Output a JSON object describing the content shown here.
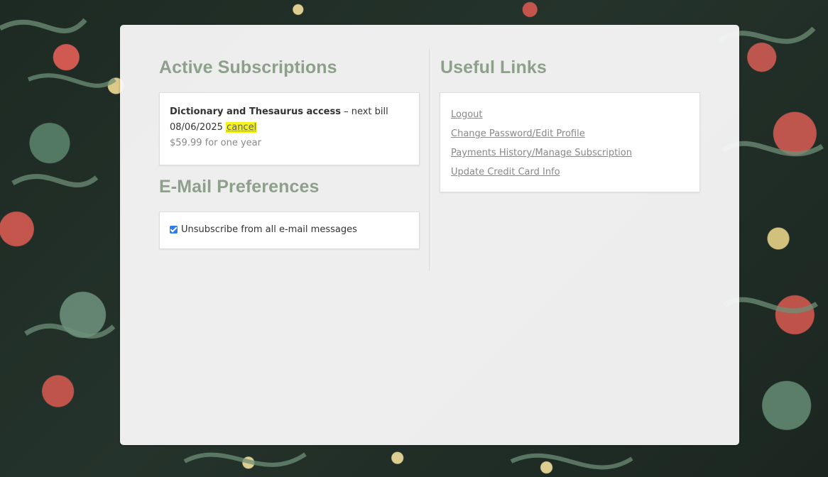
{
  "sections": {
    "active_subscriptions": {
      "title": "Active Subscriptions",
      "subscription": {
        "name": "Dictionary and Thesaurus access",
        "bill_text": " – next bill",
        "bill_date": "08/06/2025",
        "cancel_label": "cancel",
        "price": "$59.99 for one year"
      }
    },
    "email_preferences": {
      "title": "E-Mail Preferences",
      "checkbox_label": "Unsubscribe from all e-mail messages",
      "checked": true
    },
    "useful_links": {
      "title": "Useful Links",
      "items": [
        {
          "label": "Logout"
        },
        {
          "label": "Change Password/Edit Profile"
        },
        {
          "label": "Payments History/Manage Subscription"
        },
        {
          "label": "Update Credit Card Info"
        }
      ]
    }
  },
  "colors": {
    "heading": "#8ea08c",
    "link": "#888888",
    "highlight": "#f4f31b",
    "checkbox": "#2f7ee8"
  }
}
